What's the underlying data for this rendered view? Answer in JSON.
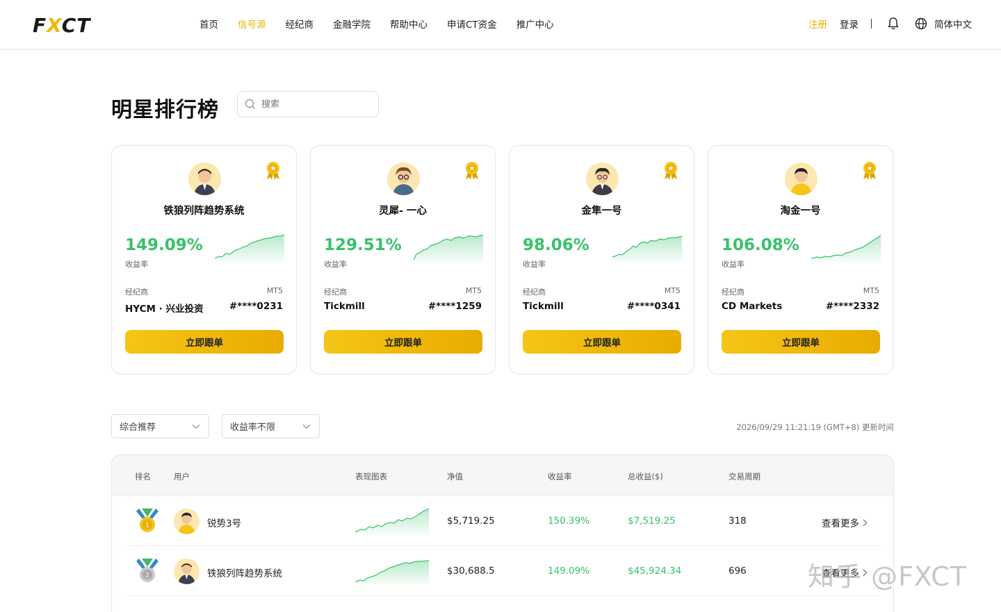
{
  "header": {
    "logo": "FXCT",
    "nav": [
      "首页",
      "信号源",
      "经纪商",
      "金融学院",
      "帮助中心",
      "申请CT资金",
      "推广中心"
    ],
    "active_nav": 1,
    "register": "注册",
    "login": "登录",
    "language": "简体中文",
    "icons": [
      "bell-icon",
      "globe-icon"
    ]
  },
  "main": {
    "title": "明星排行榜",
    "search_placeholder": "搜索"
  },
  "star_cards": [
    {
      "name": "铁狼列阵趋势系统",
      "rate": "149.09%",
      "rate_label": "收益率",
      "broker_label": "经纪商",
      "platform": "MT5",
      "broker": "HYCM · 兴业投资",
      "account": "#****0231",
      "button": "立即跟单"
    },
    {
      "name": "灵犀- 一心",
      "rate": "129.51%",
      "rate_label": "收益率",
      "broker_label": "经纪商",
      "platform": "MT5",
      "broker": "Tickmill",
      "account": "#****1259",
      "button": "立即跟单"
    },
    {
      "name": "金隼一号",
      "rate": "98.06%",
      "rate_label": "收益率",
      "broker_label": "经纪商",
      "platform": "MT5",
      "broker": "Tickmill",
      "account": "#****0341",
      "button": "立即跟单"
    },
    {
      "name": "淘金一号",
      "rate": "106.08%",
      "rate_label": "收益率",
      "broker_label": "经纪商",
      "platform": "MT5",
      "broker": "CD Markets",
      "account": "#****2332",
      "button": "立即跟单"
    }
  ],
  "filters": {
    "sort": "综合推荐",
    "return_filter": "收益率不限",
    "updated": "2026/09/29 11:21:19 (GMT+8) 更新时间"
  },
  "table": {
    "headers": [
      "排名",
      "用户",
      "表现图表",
      "净值",
      "收益率",
      "总收益($)",
      "交易周期"
    ],
    "rows": [
      {
        "user": "锐势3号",
        "nav": "$5,719.25",
        "return": "150.39%",
        "profit": "$7,519.25",
        "period": "318",
        "more": "查看更多"
      },
      {
        "user": "铁狼列阵趋势系统",
        "nav": "$30,688.5",
        "return": "149.09%",
        "profit": "$45,924.34",
        "period": "696",
        "more": "查看更多"
      }
    ]
  },
  "watermark": "知乎 @FXCT",
  "colors": {
    "accent": "#e8b400",
    "positive": "#37c26a",
    "button": "#f5c518"
  }
}
